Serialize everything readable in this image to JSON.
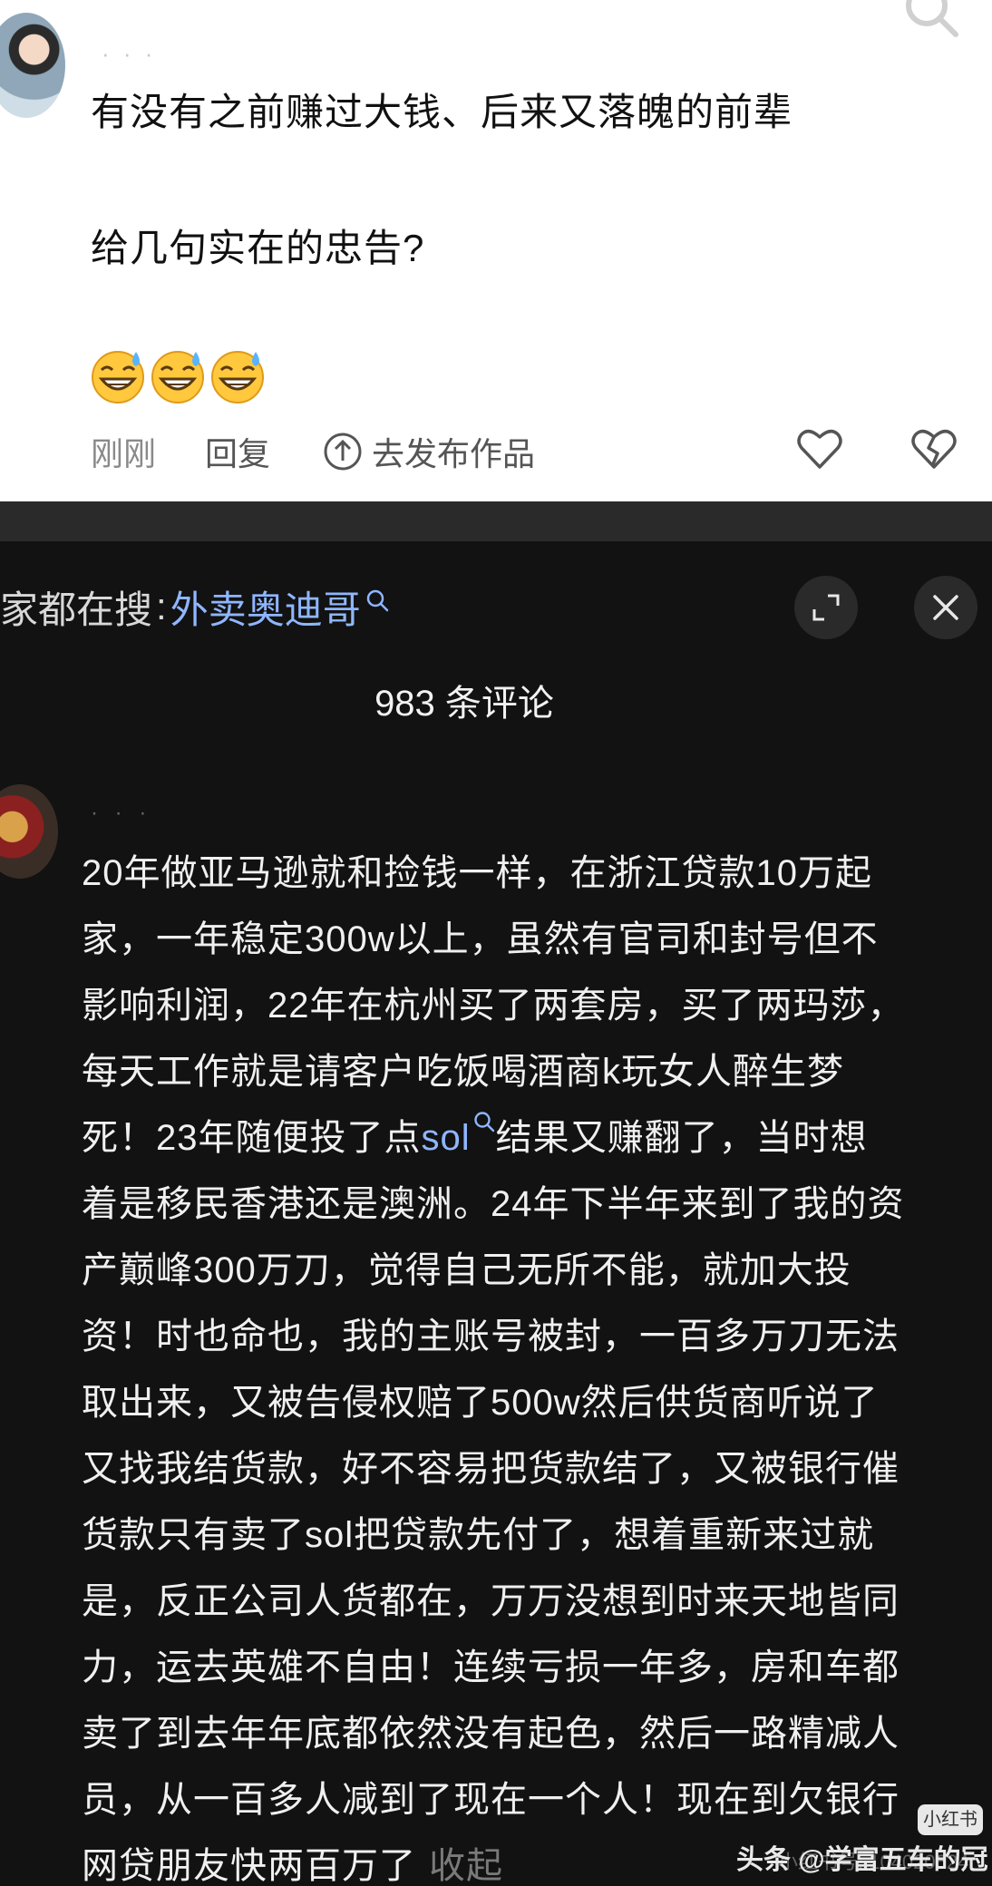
{
  "post": {
    "line1": "有没有之前赚过大钱、后来又落魄的前辈",
    "line2": "给几句实在的忠告?",
    "time": "刚刚",
    "reply": "回复",
    "publish": "去发布作品"
  },
  "icons": {
    "emoji": "sweat-grin-emoji",
    "search": "search-icon",
    "like": "heart-icon",
    "dislike": "broken-heart-icon",
    "expand": "expand-icon",
    "close": "close-icon"
  },
  "colors": {
    "keyword": "#8fb6ff",
    "dark_bg": "#121212",
    "light_bg": "#ffffff"
  },
  "search": {
    "prefix": "家都在搜",
    "sep": ":",
    "keyword": "外卖奥迪哥"
  },
  "comments": {
    "count": "983 条评论"
  },
  "comment": {
    "lines": [
      "20年做亚马逊就和捡钱一样，在浙江贷款10万起",
      "家，一年稳定300w以上，虽然有官司和封号但不",
      "影响利润，22年在杭州买了两套房，买了两玛莎，",
      "每天工作就是请客户吃饭喝酒商k玩女人醉生梦",
      "死！23年随便投了点",
      "结果又赚翻了，当时想",
      "着是移民香港还是澳洲。24年下半年来到了我的资",
      "产巅峰300万刀，觉得自己无所不能，就加大投",
      "资！时也命也，我的主账号被封，一百多万刀无法",
      "取出来，又被告侵权赔了500w然后供货商听说了",
      "又找我结货款，好不容易把货款结了，又被银行催",
      "货款只有卖了sol把贷款先付了，想着重新来过就",
      "是，反正公司人货都在，万万没想到时来天地皆同",
      "力，运去英雄不自由！连续亏损一年多，房和车都",
      "卖了到去年年底都依然没有起色，然后一路精减人",
      "员，从一百多人减到了现在一个人！现在到欠银行",
      "网贷朋友快两百万了"
    ],
    "link": "sol",
    "collapse": "收起"
  },
  "watermark": {
    "badge": "小红书",
    "source": "头条 @学富五车的冠",
    "id": "小红书号: 104020624"
  }
}
